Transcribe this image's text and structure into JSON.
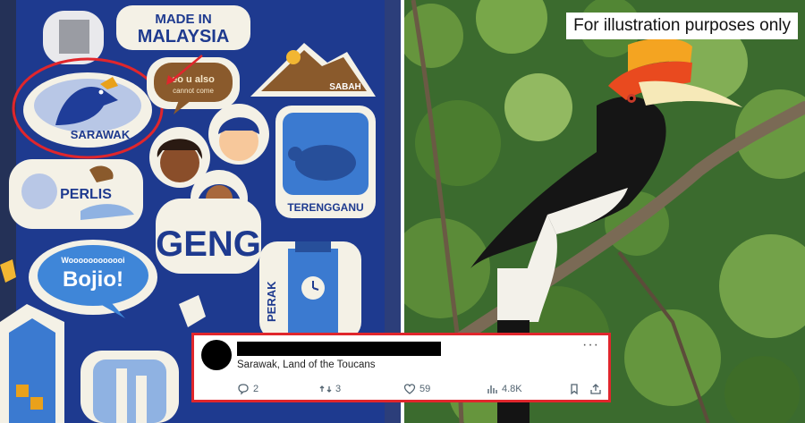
{
  "caption": "For illustration purposes only",
  "stickers": {
    "made_in": "MADE IN",
    "malaysia": "MALAYSIA",
    "sarawak": "SARAWAK",
    "bubble": "eo u also",
    "bubble_sub": "cannot come",
    "sabah": "SABAH",
    "perlis": "PERLIS",
    "terengganu": "TERENGGANU",
    "geng": "GENG",
    "bojio_small": "Woooooooooooi",
    "bojio": "Bojio!",
    "perak": "PERAK"
  },
  "tweet": {
    "text": "Sarawak, Land of the Toucans",
    "replies": "2",
    "reposts": "3",
    "likes": "59",
    "views": "4.8K",
    "more_label": "···"
  },
  "colors": {
    "highlight": "#e0262c",
    "sticker_bg": "#1e3a8f"
  }
}
